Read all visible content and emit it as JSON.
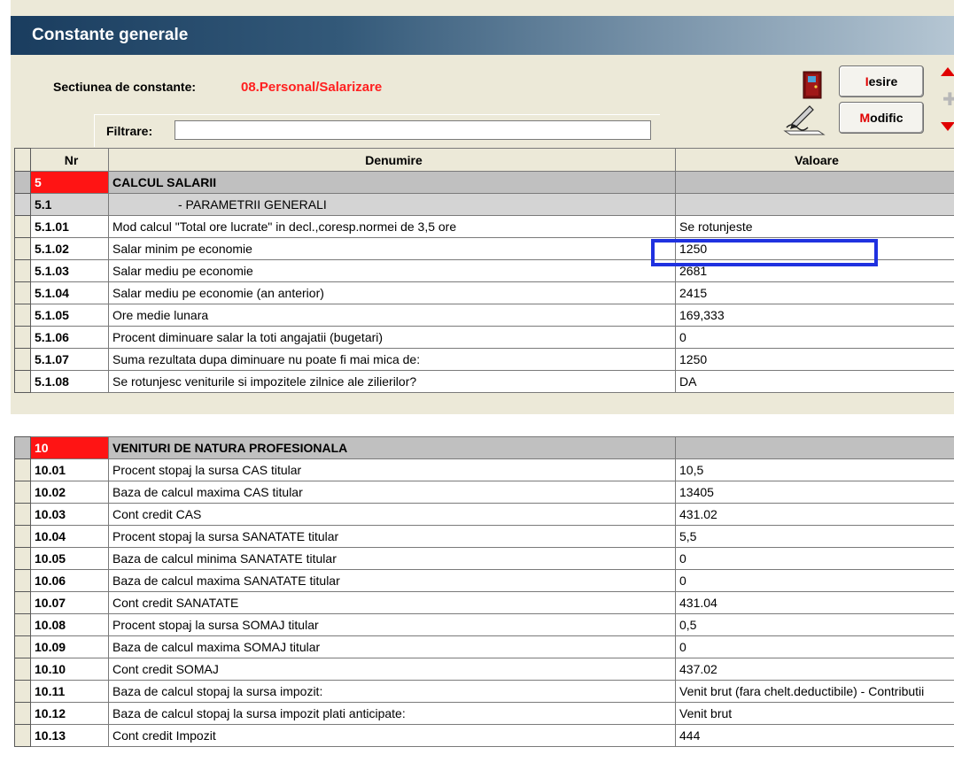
{
  "window": {
    "title": "Constante generale"
  },
  "section": {
    "label": "Sectiunea de constante:",
    "value": "08.Personal/Salarizare"
  },
  "filter": {
    "label": "Filtrare:",
    "value": ""
  },
  "buttons": {
    "iesire": {
      "hot": "I",
      "rest": "esire"
    },
    "modific": {
      "hot": "M",
      "rest": "odific"
    }
  },
  "icons": {
    "exit": "door-icon",
    "modify": "pen-paper-icon",
    "up": "arrow-up-icon",
    "add": "plus-icon",
    "down": "arrow-down-icon"
  },
  "colors": {
    "title_gradient_start": "#1a3d5f",
    "accent_red": "#ff2020",
    "group_row": "#c0c0c0",
    "highlight": "#1f31e0"
  },
  "table": {
    "headers": {
      "nr": "Nr",
      "denumire": "Denumire",
      "valoare": "Valoare"
    },
    "group1": {
      "title": {
        "nr": "5",
        "denumire": "CALCUL SALARII",
        "valoare": ""
      },
      "subtitle": {
        "nr": "5.1",
        "denumire": "- PARAMETRII GENERALI",
        "valoare": ""
      },
      "rows": [
        {
          "nr": "5.1.01",
          "denumire": "Mod calcul \"Total ore lucrate\" in decl.,coresp.normei de 3,5 ore",
          "valoare": "Se rotunjeste"
        },
        {
          "nr": "5.1.02",
          "denumire": "Salar minim pe economie",
          "valoare": "1250"
        },
        {
          "nr": "5.1.03",
          "denumire": "Salar mediu pe economie",
          "valoare": "2681"
        },
        {
          "nr": "5.1.04",
          "denumire": "Salar mediu pe economie (an anterior)",
          "valoare": "2415"
        },
        {
          "nr": "5.1.05",
          "denumire": "Ore medie lunara",
          "valoare": "169,333"
        },
        {
          "nr": "5.1.06",
          "denumire": "Procent diminuare salar la toti angajatii (bugetari)",
          "valoare": "0"
        },
        {
          "nr": "5.1.07",
          "denumire": "Suma rezultata dupa diminuare nu poate fi mai mica de:",
          "valoare": "1250"
        },
        {
          "nr": "5.1.08",
          "denumire": "Se rotunjesc veniturile si impozitele zilnice ale zilierilor?",
          "valoare": "DA"
        }
      ]
    },
    "group2": {
      "title": {
        "nr": "10",
        "denumire": "VENITURI DE NATURA PROFESIONALA",
        "valoare": ""
      },
      "rows": [
        {
          "nr": "10.01",
          "denumire": "Procent stopaj la sursa CAS titular",
          "valoare": "10,5"
        },
        {
          "nr": "10.02",
          "denumire": "Baza de calcul maxima CAS titular",
          "valoare": "13405"
        },
        {
          "nr": "10.03",
          "denumire": "Cont credit CAS",
          "valoare": "431.02"
        },
        {
          "nr": "10.04",
          "denumire": "Procent stopaj la sursa SANATATE titular",
          "valoare": "5,5"
        },
        {
          "nr": "10.05",
          "denumire": "Baza de calcul minima SANATATE titular",
          "valoare": "0"
        },
        {
          "nr": "10.06",
          "denumire": "Baza de calcul maxima SANATATE titular",
          "valoare": "0"
        },
        {
          "nr": "10.07",
          "denumire": "Cont credit SANATATE",
          "valoare": "431.04"
        },
        {
          "nr": "10.08",
          "denumire": "Procent stopaj la sursa SOMAJ titular",
          "valoare": "0,5"
        },
        {
          "nr": "10.09",
          "denumire": "Baza de calcul maxima SOMAJ titular",
          "valoare": "0"
        },
        {
          "nr": "10.10",
          "denumire": "Cont credit SOMAJ",
          "valoare": "437.02"
        },
        {
          "nr": "10.11",
          "denumire": "Baza de calcul stopaj la sursa impozit:",
          "valoare": "Venit brut (fara chelt.deductibile) - Contributii"
        },
        {
          "nr": "10.12",
          "denumire": "Baza de calcul stopaj la sursa impozit plati anticipate:",
          "valoare": "Venit brut"
        },
        {
          "nr": "10.13",
          "denumire": "Cont credit Impozit",
          "valoare": "444"
        }
      ]
    }
  }
}
